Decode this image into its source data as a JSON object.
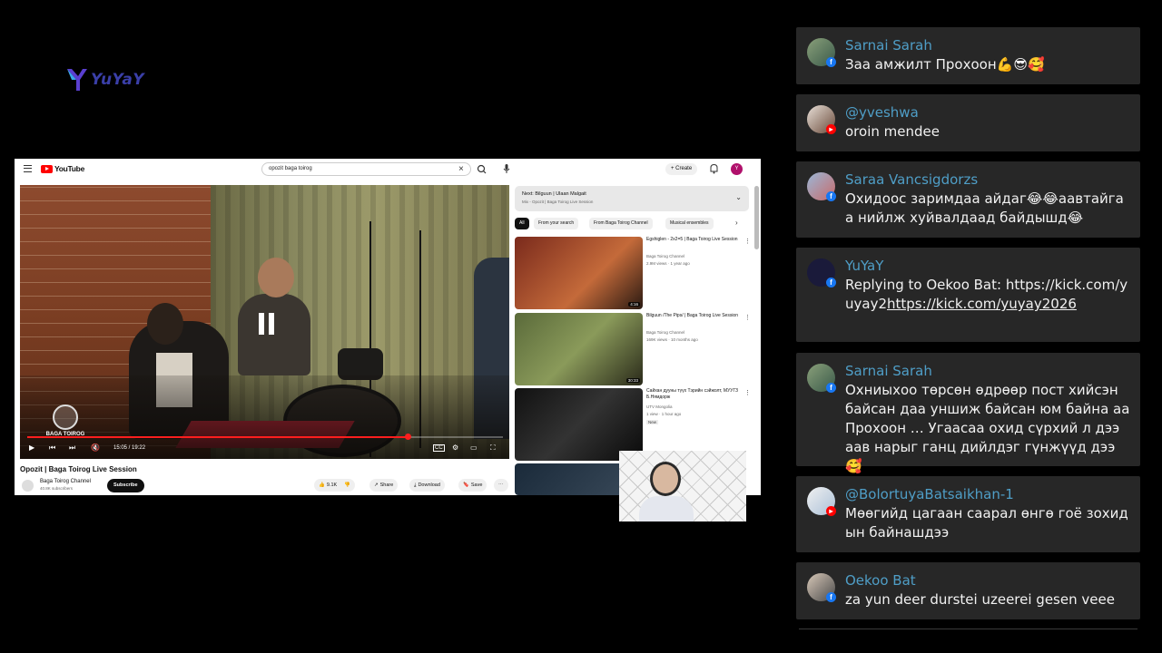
{
  "logo": {
    "text": "YuYaY"
  },
  "youtube": {
    "brand": "YouTube",
    "search_value": "opozit baga toirog",
    "create_label": "Create",
    "avatar_letter": "Y",
    "player": {
      "watermark": "BAGA TOIROG",
      "time": "15:05 / 19:22",
      "progress_fraction": 0.8
    },
    "video_title": "Opozit | Baga Toirog Live Session",
    "channel_name": "Baga Toirog Channel",
    "channel_subs": "40.8K subscribers",
    "subscribe_label": "Subscribe",
    "likes": "9.1K",
    "share_label": "Share",
    "download_label": "Download",
    "save_label": "Save",
    "upnext_title": "Next: Bilguun | Ulaan Malgait",
    "upnext_sub": "Mix - Opozit | Baga Toirog Live Session",
    "chips": [
      "All",
      "From your search",
      "From Baga Toirog Channel",
      "Musical ensembles"
    ],
    "recommendations": [
      {
        "title": "Egshiglen - 2x2=5 | Baga Toirog Live Session",
        "channel": "Baga Toirog Channel",
        "meta": "2.9M views · 1 year ago",
        "duration": "4:16",
        "badge": ""
      },
      {
        "title": "Bilguun /The Pips/ | Baga Toirog Live Session",
        "channel": "Baga Toirog Channel",
        "meta": "169K views · 10 months ago",
        "duration": "30:33",
        "badge": ""
      },
      {
        "title": "Сайхан дууны түүх Тэрийн сэйжолт, МУУГЗ Б.Нямдорж",
        "channel": "UTV Mongolia",
        "meta": "1 view · 1 hour ago",
        "duration": "",
        "badge": "New"
      }
    ]
  },
  "chat": {
    "messages": [
      {
        "name": "Sarnai Sarah",
        "platform": "facebook",
        "text": "Заа амжилт Прохоон💪😎🥰"
      },
      {
        "name": "@yveshwa",
        "platform": "youtube",
        "text": "oroin mendee"
      },
      {
        "name": "Saraa Vancsigdorzs",
        "platform": "facebook",
        "text": "Охидоос заримдаа айдаг😂😂аавтайгаа нийлж хуйвалдаад байдышд😂"
      },
      {
        "name": "YuYaY",
        "platform": "facebook",
        "text_prefix": "Replying to Oekoo Bat: https://kick.com/yuyay2",
        "text_link": "https://kick.com/yuyay2026"
      },
      {
        "name": "Sarnai Sarah",
        "platform": "facebook",
        "text": "Охниыхоо төрсөн өдрөөр пост хийсэн байсан даа уншиж байсан юм байна аа Прохоон … Угаасаа охид сүрхий л дээ аав нарыг ганц дийлдэг гүнжүүд дээ🥰"
      },
      {
        "name": "@BolortuyaBatsaikhan-1",
        "platform": "youtube",
        "text": "Мөөгийд цагаан саарал өнгө гоё зохидын байнашдээ"
      },
      {
        "name": "Oekoo Bat",
        "platform": "facebook",
        "text": "za yun deer durstei uzeerei gesen veee"
      }
    ]
  },
  "colors": {
    "chat_bg": "#272727",
    "chat_name": "#4f9ec7",
    "yt_red": "#ff0000",
    "fb_blue": "#1877f2"
  }
}
